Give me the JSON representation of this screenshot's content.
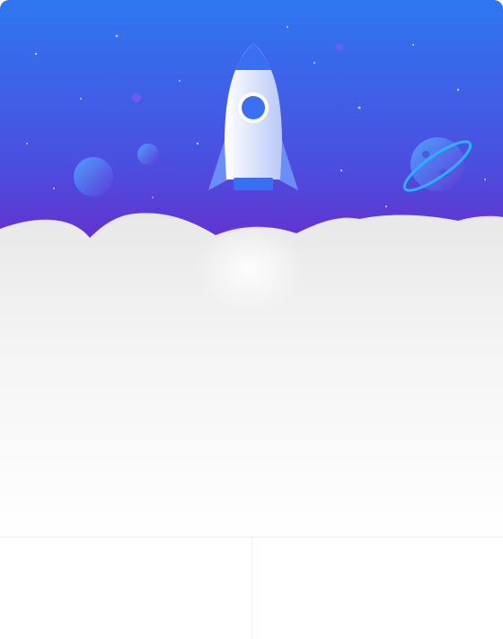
{
  "dialog": {
    "title": "",
    "body": "",
    "note": ""
  },
  "buttons": {
    "secondary_label": "",
    "primary_label": ""
  },
  "colors": {
    "sky_top": "#2f77f0",
    "sky_bottom": "#6b28c8",
    "rocket_body": "#e8efff",
    "rocket_accent": "#3b6ff2",
    "planet": "#4a7df4",
    "cloud": "#f4f4f4"
  },
  "icons": {
    "rocket": "rocket-illustration",
    "planet": "planet-illustration"
  }
}
